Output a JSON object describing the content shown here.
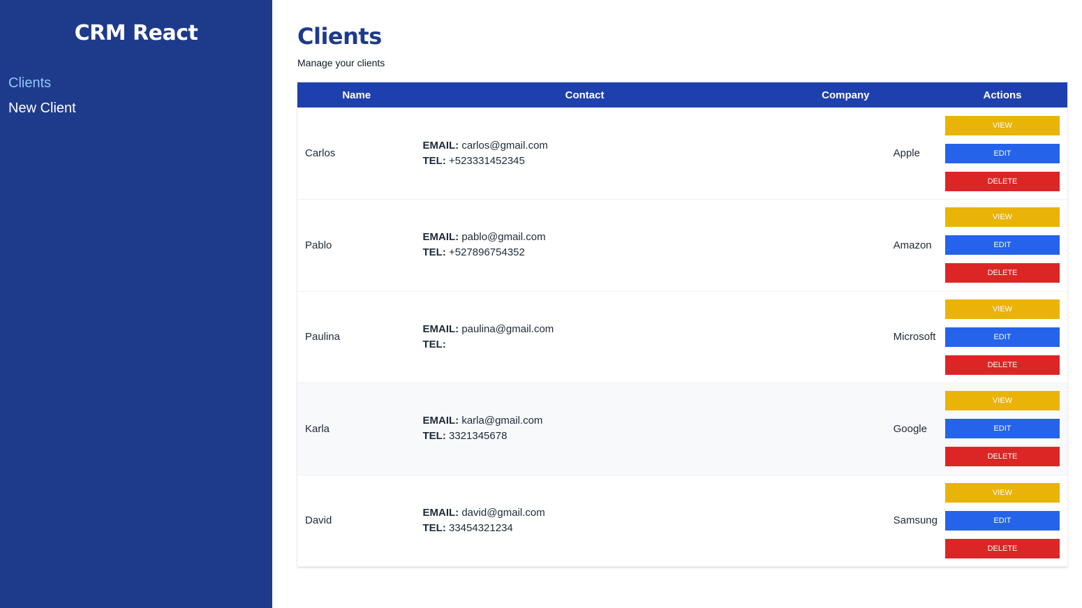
{
  "sidebar": {
    "brand": "CRM React",
    "nav": [
      {
        "label": "Clients",
        "active": true
      },
      {
        "label": "New Client",
        "active": false
      }
    ]
  },
  "main": {
    "title": "Clients",
    "subtitle": "Manage your clients"
  },
  "table": {
    "headers": [
      "Name",
      "Contact",
      "Company",
      "Actions"
    ],
    "email_label": "EMAIL:",
    "tel_label": "TEL:",
    "actions": {
      "view": "VIEW",
      "edit": "EDIT",
      "delete": "DELETE"
    },
    "rows": [
      {
        "name": "Carlos",
        "email": "carlos@gmail.com",
        "tel": "+523331452345",
        "company": "Apple"
      },
      {
        "name": "Pablo",
        "email": "pablo@gmail.com",
        "tel": "+527896754352",
        "company": "Amazon"
      },
      {
        "name": "Paulina",
        "email": "paulina@gmail.com",
        "tel": "",
        "company": "Microsoft"
      },
      {
        "name": "Karla",
        "email": "karla@gmail.com",
        "tel": "3321345678",
        "company": "Google"
      },
      {
        "name": "David",
        "email": "david@gmail.com",
        "tel": "33454321234",
        "company": "Samsung"
      }
    ]
  },
  "colors": {
    "sidebar_bg": "#1e3a8a",
    "header_bg": "#1e40af",
    "view_button": "#eab308",
    "edit_button": "#2563eb",
    "delete_button": "#dc2626",
    "active_nav": "#93c5fd"
  }
}
